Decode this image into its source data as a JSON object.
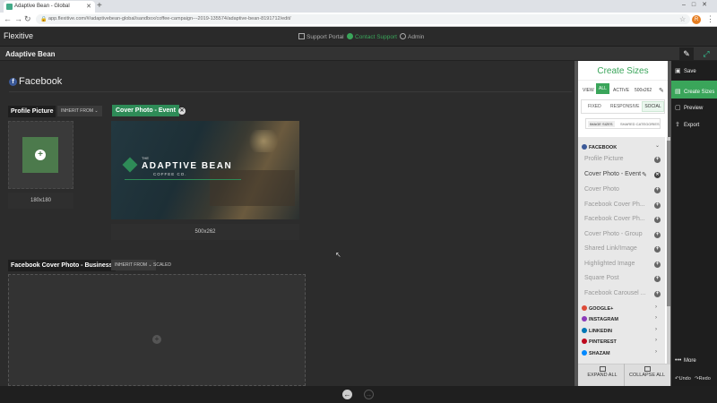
{
  "browser": {
    "tab_title": "Adaptive Bean - Global",
    "new_tab": "+",
    "url": "app.flexitive.com/#/adaptivebean-global/sandbox/coffee-campaign---2019-135574/adaptive-bean-8191712/edit/",
    "avatar": "R"
  },
  "header": {
    "logo": "Flexitive",
    "links": [
      {
        "label": "Support Portal",
        "icon": "document-icon"
      },
      {
        "label": "Contact Support",
        "icon": "help-icon",
        "color": "#3aa55a"
      },
      {
        "label": "Admin",
        "icon": "gear-icon"
      }
    ]
  },
  "project": {
    "name": "Adaptive Bean"
  },
  "canvas": {
    "section_title": "Facebook",
    "profile": {
      "label": "Profile Picture",
      "inherit": "INHERIT FROM",
      "dims": "180x180"
    },
    "cover": {
      "label": "Cover Photo - Event",
      "dims": "500x262",
      "brand_pre": "THE",
      "brand_title": "ADAPTIVE BEAN",
      "brand_sub": "COFFEE CO."
    },
    "business": {
      "label": "Facebook Cover Photo - Business",
      "inherit": "INHERIT FROM",
      "scaled": "SCALED"
    }
  },
  "panel": {
    "title": "Create Sizes",
    "view_label": "VIEW",
    "view_chips": [
      "ALL",
      "ACTIVE",
      "500x262"
    ],
    "type_tabs": [
      "FIXED",
      "RESPONSIVE",
      "SOCIAL"
    ],
    "sub_tabs": [
      "IMAGE SIZES",
      "SHARED CATEGORIES"
    ],
    "facebook_section": "FACEBOOK",
    "facebook_items": [
      "Profile Picture",
      "Cover Photo - Event",
      "Cover Photo",
      "Facebook Cover Ph...",
      "Facebook Cover Ph...",
      "Cover Photo - Group",
      "Shared Link/Image",
      "Highlighted Image",
      "Square Post",
      "Facebook Carousel ..."
    ],
    "other_sections": [
      {
        "label": "GOOGLE+",
        "color": "#dd4b39"
      },
      {
        "label": "INSTAGRAM",
        "color": "#8a3ab9"
      },
      {
        "label": "LINKEDIN",
        "color": "#0077b5"
      },
      {
        "label": "PINTEREST",
        "color": "#bd081c"
      },
      {
        "label": "SHAZAM",
        "color": "#0088ff"
      }
    ],
    "expand_all": "EXPAND ALL",
    "collapse_all": "COLLAPSE ALL"
  },
  "rail": {
    "save": "Save",
    "create_sizes": "Create Sizes",
    "preview": "Preview",
    "export": "Export",
    "more": "More",
    "undo": "Undo",
    "redo": "Redo"
  },
  "colors": {
    "accent": "#3aa55a",
    "facebook": "#3b5998"
  }
}
